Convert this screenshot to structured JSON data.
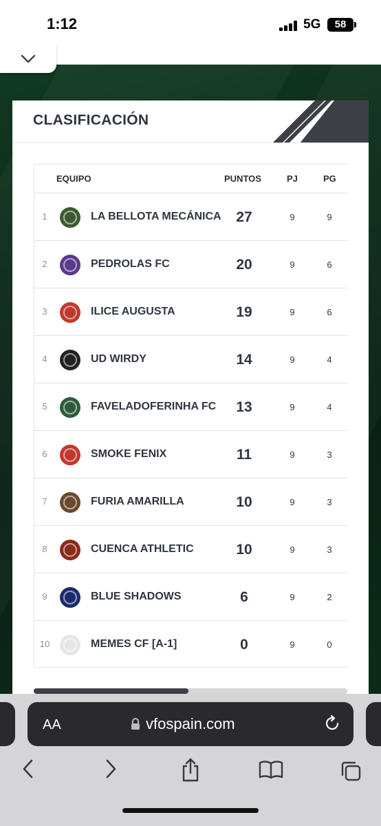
{
  "status_bar": {
    "time": "1:12",
    "network": "5G",
    "battery": "58"
  },
  "card": {
    "title": "CLASIFICACIÓN"
  },
  "table": {
    "headers": {
      "team": "EQUIPO",
      "points": "PUNTOS",
      "played": "PJ",
      "won": "PG"
    },
    "rows": [
      {
        "pos": "1",
        "team": "LA BELLOTA MECÁNICA",
        "points": "27",
        "played": "9",
        "won": "9",
        "logo_color": "#3d5a2e"
      },
      {
        "pos": "2",
        "team": "PEDROLAS FC",
        "points": "20",
        "played": "9",
        "won": "6",
        "logo_color": "#5b3a8c"
      },
      {
        "pos": "3",
        "team": "ILICE AUGUSTA",
        "points": "19",
        "played": "9",
        "won": "6",
        "logo_color": "#c0392b"
      },
      {
        "pos": "4",
        "team": "UD WIRDY",
        "points": "14",
        "played": "9",
        "won": "4",
        "logo_color": "#222222"
      },
      {
        "pos": "5",
        "team": "FAVELADOFERINHA FC",
        "points": "13",
        "played": "9",
        "won": "4",
        "logo_color": "#2e5a3a"
      },
      {
        "pos": "6",
        "team": "SMOKE FENIX",
        "points": "11",
        "played": "9",
        "won": "3",
        "logo_color": "#c0392b"
      },
      {
        "pos": "7",
        "team": "FURIA AMARILLA",
        "points": "10",
        "played": "9",
        "won": "3",
        "logo_color": "#6b4a2b"
      },
      {
        "pos": "8",
        "team": "CUENCA ATHLETIC",
        "points": "10",
        "played": "9",
        "won": "3",
        "logo_color": "#8b2a1a"
      },
      {
        "pos": "9",
        "team": "BLUE SHADOWS",
        "points": "6",
        "played": "9",
        "won": "2",
        "logo_color": "#1b2a6b"
      },
      {
        "pos": "10",
        "team": "MEMES CF [A-1]",
        "points": "0",
        "played": "9",
        "won": "0",
        "logo_color": "#e6e6e6"
      }
    ]
  },
  "browser": {
    "text_size_label": "AA",
    "url": "vfospain.com"
  },
  "colors": {
    "page_bg": "#0b2a19",
    "card_bg": "#ffffff",
    "accent_dark": "#3d4047",
    "browser_bar": "#d5d5d7"
  },
  "icons": [
    "chevron-down-icon",
    "lock-icon",
    "reload-icon",
    "back-icon",
    "forward-icon",
    "share-icon",
    "bookmarks-icon",
    "tabs-icon"
  ]
}
